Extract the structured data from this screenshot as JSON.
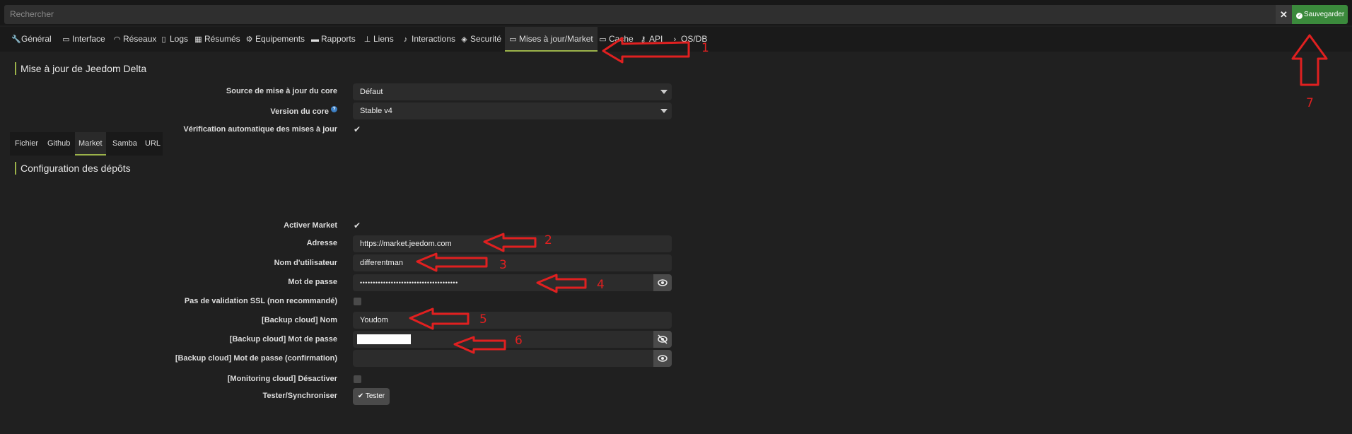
{
  "search": {
    "placeholder": "Rechercher"
  },
  "toolbar": {
    "clear_label": "✕",
    "save_label": "Sauvegarder"
  },
  "tabs": [
    {
      "label": "Général",
      "icon": "wrench-icon"
    },
    {
      "label": "Interface",
      "icon": "laptop-icon"
    },
    {
      "label": "Réseaux",
      "icon": "rss-icon"
    },
    {
      "label": "Logs",
      "icon": "file-icon"
    },
    {
      "label": "Résumés",
      "icon": "table-icon"
    },
    {
      "label": "Equipements",
      "icon": "gear-icon"
    },
    {
      "label": "Rapports",
      "icon": "newspaper-icon"
    },
    {
      "label": "Liens",
      "icon": "sitemap-icon"
    },
    {
      "label": "Interactions",
      "icon": "microphone-icon"
    },
    {
      "label": "Securité",
      "icon": "shield-icon"
    },
    {
      "label": "Mises à jour/Market",
      "icon": "credit-card-icon"
    },
    {
      "label": "Cache",
      "icon": "hdd-icon"
    },
    {
      "label": "API",
      "icon": "key-icon"
    },
    {
      "label": "OS/DB",
      "icon": "terminal-icon"
    }
  ],
  "update_section": {
    "title": "Mise à jour de Jeedom Delta",
    "source_label": "Source de mise à jour du core",
    "source_value": "Défaut",
    "version_label": "Version du core",
    "version_value": "Stable v4",
    "autocheck_label": "Vérification automatique des mises à jour"
  },
  "repo_section": {
    "title": "Configuration des dépôts",
    "subtabs": [
      "Fichier",
      "Github",
      "Market",
      "Samba",
      "URL"
    ]
  },
  "market": {
    "activate_label": "Activer Market",
    "address_label": "Adresse",
    "address_value": "https://market.jeedom.com",
    "username_label": "Nom d'utilisateur",
    "username_value": "differentman",
    "password_label": "Mot de passe",
    "password_value": "••••••••••••••••••••••••••••••••••••••",
    "ssl_label": "Pas de validation SSL (non recommandé)",
    "backup_name_label": "[Backup cloud] Nom",
    "backup_name_value": "Youdom",
    "backup_pass_label": "[Backup cloud] Mot de passe",
    "backup_pass_confirm_label": "[Backup cloud] Mot de passe (confirmation)",
    "monitoring_label": "[Monitoring cloud] Désactiver",
    "test_label": "Tester/Synchroniser",
    "test_button": "Tester"
  },
  "annotations": [
    "1",
    "2",
    "3",
    "4",
    "5",
    "6",
    "7"
  ],
  "colors": {
    "accent": "#9bb24a",
    "save": "#3b8a3c",
    "annotation": "#e02020"
  }
}
